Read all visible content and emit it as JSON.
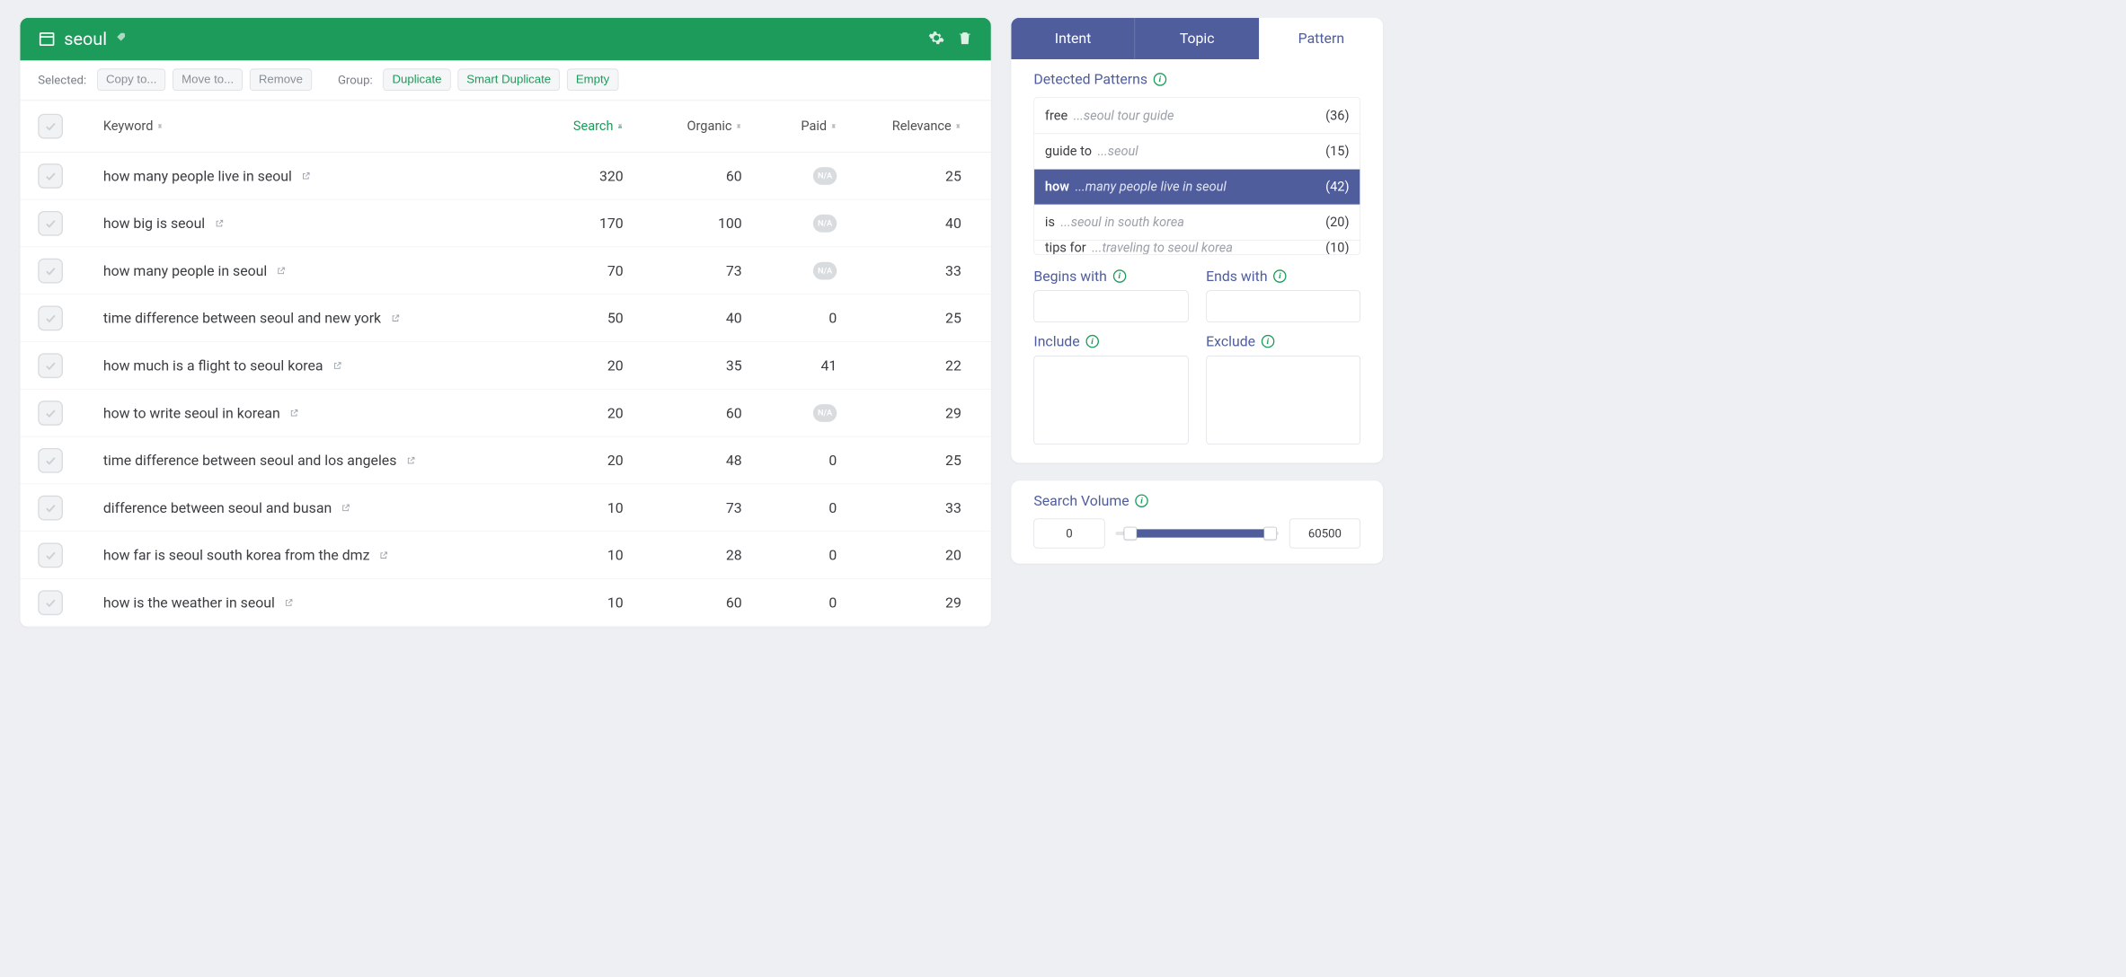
{
  "header": {
    "title": "seoul"
  },
  "toolbar": {
    "selected_label": "Selected:",
    "copy_to": "Copy to...",
    "move_to": "Move to...",
    "remove": "Remove",
    "group_label": "Group:",
    "duplicate": "Duplicate",
    "smart_duplicate": "Smart Duplicate",
    "empty": "Empty"
  },
  "columns": {
    "keyword": "Keyword",
    "search": "Search",
    "organic": "Organic",
    "paid": "Paid",
    "relevance": "Relevance"
  },
  "rows": [
    {
      "keyword": "how many people live in seoul",
      "search": "320",
      "organic": "60",
      "paid": "N/A",
      "relevance": "25"
    },
    {
      "keyword": "how big is seoul",
      "search": "170",
      "organic": "100",
      "paid": "N/A",
      "relevance": "40"
    },
    {
      "keyword": "how many people in seoul",
      "search": "70",
      "organic": "73",
      "paid": "N/A",
      "relevance": "33"
    },
    {
      "keyword": "time difference between seoul and new york",
      "search": "50",
      "organic": "40",
      "paid": "0",
      "relevance": "25"
    },
    {
      "keyword": "how much is a flight to seoul korea",
      "search": "20",
      "organic": "35",
      "paid": "41",
      "relevance": "22"
    },
    {
      "keyword": "how to write seoul in korean",
      "search": "20",
      "organic": "60",
      "paid": "N/A",
      "relevance": "29"
    },
    {
      "keyword": "time difference between seoul and los angeles",
      "search": "20",
      "organic": "48",
      "paid": "0",
      "relevance": "25"
    },
    {
      "keyword": "difference between seoul and busan",
      "search": "10",
      "organic": "73",
      "paid": "0",
      "relevance": "33"
    },
    {
      "keyword": "how far is seoul south korea from the dmz",
      "search": "10",
      "organic": "28",
      "paid": "0",
      "relevance": "20"
    },
    {
      "keyword": "how is the weather in seoul",
      "search": "10",
      "organic": "60",
      "paid": "0",
      "relevance": "29"
    }
  ],
  "sidebar": {
    "tabs": {
      "intent": "Intent",
      "topic": "Topic",
      "pattern": "Pattern"
    },
    "detected_patterns_label": "Detected Patterns",
    "patterns": [
      {
        "prefix": "free",
        "suffix": "...seoul tour guide",
        "count": "(36)",
        "active": false
      },
      {
        "prefix": "guide to",
        "suffix": "...seoul",
        "count": "(15)",
        "active": false
      },
      {
        "prefix": "how",
        "suffix": "...many people live in seoul",
        "count": "(42)",
        "active": true
      },
      {
        "prefix": "is",
        "suffix": "...seoul in south korea",
        "count": "(20)",
        "active": false
      },
      {
        "prefix": "tips for",
        "suffix": "...traveling to seoul korea",
        "count": "(10)",
        "active": false
      }
    ],
    "filters": {
      "begins_with": "Begins with",
      "ends_with": "Ends with",
      "include": "Include",
      "exclude": "Exclude"
    },
    "search_volume": {
      "label": "Search Volume",
      "min": "0",
      "max": "60500"
    }
  }
}
